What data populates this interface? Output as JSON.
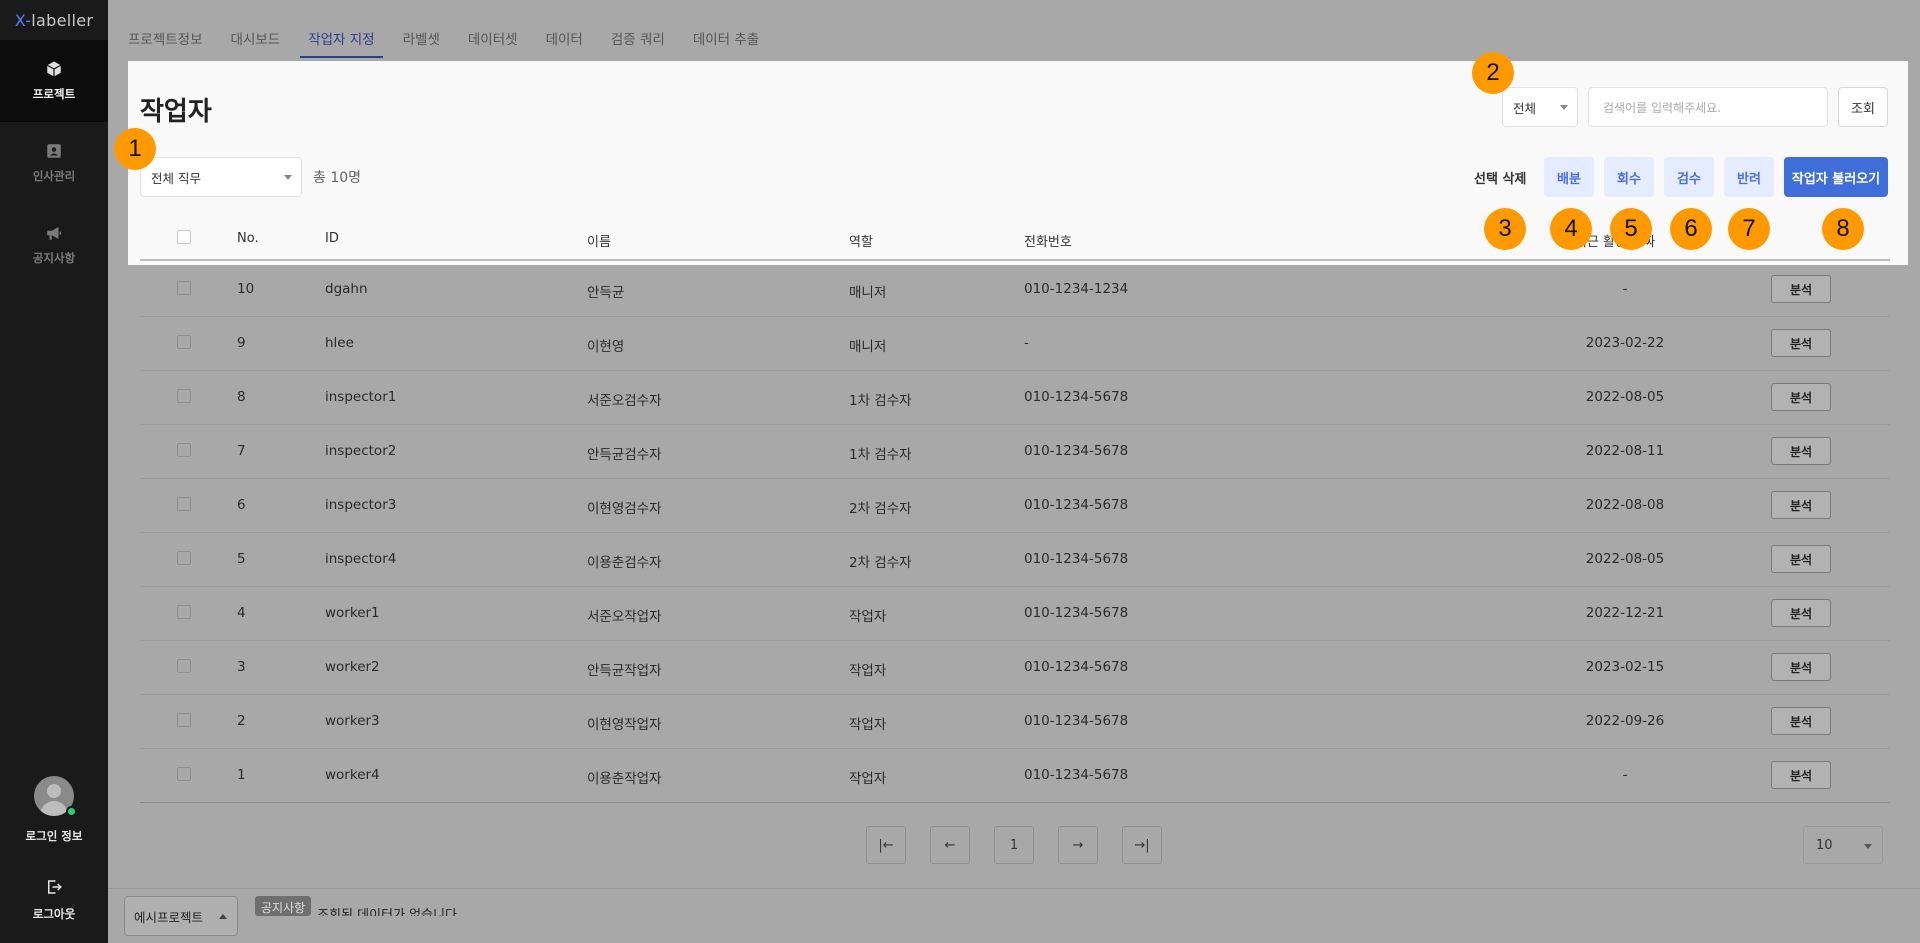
{
  "app": {
    "logo_prefix": "X-",
    "logo_suffix": "labeller"
  },
  "sidebar": {
    "items": [
      {
        "label": "프로젝트",
        "icon": "box-icon",
        "active": true
      },
      {
        "label": "인사관리",
        "icon": "id-card-icon",
        "active": false
      },
      {
        "label": "공지사항",
        "icon": "megaphone-icon",
        "active": false
      }
    ],
    "profile_label": "로그인 정보",
    "logout_label": "로그아웃"
  },
  "tabs": [
    "프로젝트정보",
    "대시보드",
    "작업자 지정",
    "라벨셋",
    "데이터셋",
    "데이터",
    "검증 쿼리",
    "데이터 추출"
  ],
  "active_tab": "작업자 지정",
  "header": {
    "title": "작업자",
    "filter_select": "전체",
    "search_placeholder": "검색어를 입력해주세요.",
    "query_button": "조회"
  },
  "toolbar": {
    "role_filter": "전체 직무",
    "total": "총 10명",
    "delete_label": "선택 삭제",
    "distribute_label": "배분",
    "recall_label": "회수",
    "inspect_label": "검수",
    "reject_label": "반려",
    "load_workers_label": "작업자 불러오기"
  },
  "badges": [
    "1",
    "2",
    "3",
    "4",
    "5",
    "6",
    "7",
    "8"
  ],
  "table": {
    "headers": {
      "no": "No.",
      "id": "ID",
      "name": "이름",
      "role": "역할",
      "phone": "전화번호",
      "recent_date": "최근 활동 날짜"
    },
    "action_label": "분석",
    "rows": [
      {
        "no": "10",
        "id": "dgahn",
        "name": "안득균",
        "role": "매니저",
        "phone": "010-1234-1234",
        "date": "-"
      },
      {
        "no": "9",
        "id": "hlee",
        "name": "이현영",
        "role": "매니저",
        "phone": "-",
        "date": "2023-02-22"
      },
      {
        "no": "8",
        "id": "inspector1",
        "name": "서준오검수자",
        "role": "1차 검수자",
        "phone": "010-1234-5678",
        "date": "2022-08-05"
      },
      {
        "no": "7",
        "id": "inspector2",
        "name": "안득균검수자",
        "role": "1차 검수자",
        "phone": "010-1234-5678",
        "date": "2022-08-11"
      },
      {
        "no": "6",
        "id": "inspector3",
        "name": "이현영검수자",
        "role": "2차 검수자",
        "phone": "010-1234-5678",
        "date": "2022-08-08"
      },
      {
        "no": "5",
        "id": "inspector4",
        "name": "이용춘검수자",
        "role": "2차 검수자",
        "phone": "010-1234-5678",
        "date": "2022-08-05"
      },
      {
        "no": "4",
        "id": "worker1",
        "name": "서준오작업자",
        "role": "작업자",
        "phone": "010-1234-5678",
        "date": "2022-12-21"
      },
      {
        "no": "3",
        "id": "worker2",
        "name": "안득균작업자",
        "role": "작업자",
        "phone": "010-1234-5678",
        "date": "2023-02-15"
      },
      {
        "no": "2",
        "id": "worker3",
        "name": "이현영작업자",
        "role": "작업자",
        "phone": "010-1234-5678",
        "date": "2022-09-26"
      },
      {
        "no": "1",
        "id": "worker4",
        "name": "이용춘작업자",
        "role": "작업자",
        "phone": "010-1234-5678",
        "date": "-"
      }
    ]
  },
  "pagination": {
    "first": "|←",
    "prev": "←",
    "current": "1",
    "next": "→",
    "last": "→|",
    "per_page": "10"
  },
  "footer": {
    "project": "에시프로젝트",
    "tag": "공지사항",
    "message": "조회된 데이터가 없습니다."
  },
  "colors": {
    "accent": "#3f6ed8",
    "badge": "#ff9900",
    "sidebar": "#1a1a1a"
  }
}
